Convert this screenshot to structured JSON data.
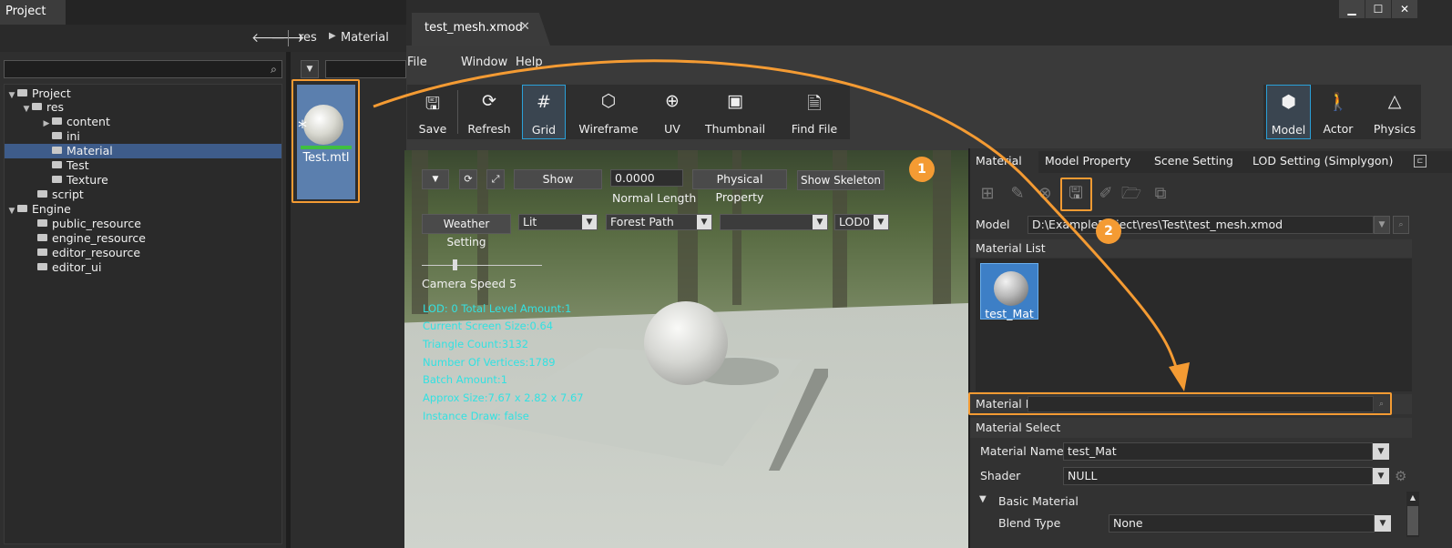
{
  "project": {
    "tab_title": "Project",
    "breadcrumb": [
      "res",
      "Material"
    ],
    "tree": [
      {
        "label": "Project",
        "expanded": true
      },
      {
        "label": "res",
        "expanded": true
      },
      {
        "label": "content",
        "expanded": false
      },
      {
        "label": "ini"
      },
      {
        "label": "Material",
        "selected": true
      },
      {
        "label": "Test"
      },
      {
        "label": "Texture"
      },
      {
        "label": "script"
      },
      {
        "label": "Engine",
        "expanded": true
      },
      {
        "label": "public_resource"
      },
      {
        "label": "engine_resource"
      },
      {
        "label": "editor_resource"
      },
      {
        "label": "editor_ui"
      }
    ],
    "file": {
      "name": "Test.mtl"
    }
  },
  "editor": {
    "doc_tab": "test_mesh.xmod",
    "menu": [
      "File",
      "Window",
      "Help"
    ],
    "tools": [
      {
        "label": "Save"
      },
      {
        "label": "Refresh"
      },
      {
        "label": "Grid",
        "active": true
      },
      {
        "label": "Wireframe"
      },
      {
        "label": "UV"
      },
      {
        "label": "Thumbnail"
      },
      {
        "label": "Find File"
      }
    ],
    "modes": [
      {
        "label": "Model",
        "active": true
      },
      {
        "label": "Actor"
      },
      {
        "label": "Physics"
      }
    ]
  },
  "viewport": {
    "show_button": "Show",
    "normal_value": "0.0000",
    "normal_length_label": "Normal Length",
    "physical_property": "Physical Property",
    "show_skeleton": "Show Skeleton",
    "weather_setting": "Weather Setting",
    "lighting": "Lit",
    "environment": "Forest Path",
    "empty_select": "",
    "lod": "LOD0",
    "camera_speed": "Camera Speed 5",
    "info_lines": [
      "LOD: 0 Total Level Amount:1",
      "Current Screen Size:0.64",
      "Triangle Count:3132",
      "Number Of Vertices:1789",
      "Batch Amount:1",
      "Approx Size:7.67 x 2.82 x 7.67",
      "Instance Draw: false"
    ]
  },
  "right_panel": {
    "tabs": [
      "Material",
      "Model Property",
      "Scene Setting",
      "LOD Setting (Simplygon)"
    ],
    "model_label": "Model",
    "model_path": "D:\\ExampleProject\\res\\Test\\test_mesh.xmod",
    "material_list_label": "Material List",
    "material_item": "test_Mat",
    "material_file_label": "Material F",
    "material_select_label": "Material Select",
    "material_name_label": "Material Name",
    "material_name": "test_Mat",
    "shader_label": "Shader",
    "shader": "NULL",
    "basic_material_label": "Basic Material",
    "blend_type_label": "Blend Type",
    "blend_type": "None"
  },
  "annotations": {
    "step1": "1",
    "step2": "2",
    "color": "#f49b33"
  }
}
